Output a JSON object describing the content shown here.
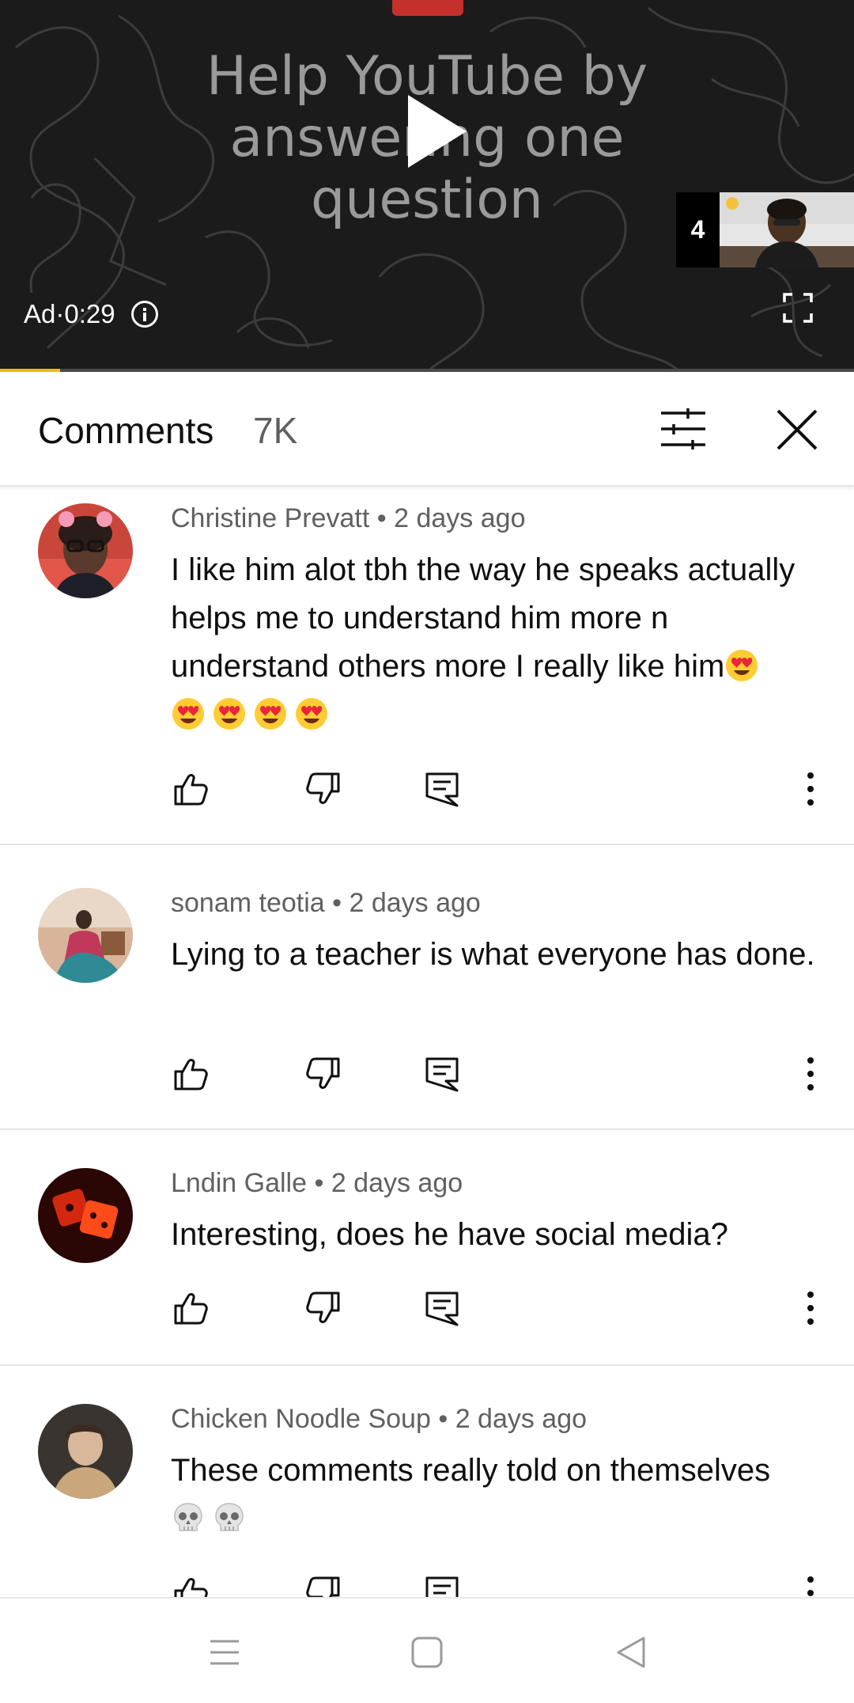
{
  "player": {
    "ad_headline_lines": [
      "Help YouTube by",
      "answering one",
      "question"
    ],
    "ad_label": "Ad·0:29",
    "ad_count": "4",
    "progress": 0.07,
    "progress_color": "#f5b800"
  },
  "comments_panel": {
    "title": "Comments",
    "count": "7K"
  },
  "comments": [
    {
      "author": "Christine Prevatt",
      "time": "2 days ago",
      "text": "I like him alot tbh the way he speaks actually helps me to understand him more n understand others more I really like him",
      "emojis": [
        "heart-eyes",
        "heart-eyes",
        "heart-eyes",
        "heart-eyes",
        "heart-eyes"
      ]
    },
    {
      "author": "sonam teotia",
      "time": "2 days ago",
      "text": "Lying to a teacher is what everyone has done.",
      "emojis": []
    },
    {
      "author": "Lndin Galle",
      "time": "2 days ago",
      "text": "Interesting, does he have social media?",
      "emojis": []
    },
    {
      "author": "Chicken Noodle Soup",
      "time": "2 days ago",
      "text": "These comments really told on themselves",
      "emojis": [
        "skull",
        "skull"
      ]
    }
  ],
  "meta_separator": " • ",
  "icons": {
    "like": "thumbs-up-icon",
    "dislike": "thumbs-down-icon",
    "reply": "reply-icon",
    "more": "more-vert-icon",
    "sort": "sort-icon",
    "close": "close-icon"
  }
}
